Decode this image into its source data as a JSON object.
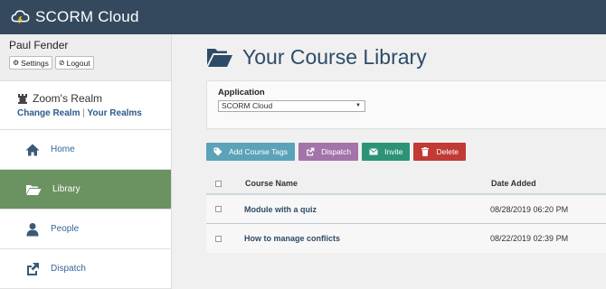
{
  "app": {
    "title": "SCORM Cloud"
  },
  "user": {
    "name": "Paul Fender",
    "settings_label": "Settings",
    "logout_label": "Logout"
  },
  "realm": {
    "name": "Zoom's Realm",
    "change_label": "Change Realm",
    "separator": "|",
    "your_realms_label": "Your Realms"
  },
  "nav": {
    "items": [
      {
        "label": "Home",
        "icon": "home-icon"
      },
      {
        "label": "Library",
        "icon": "folder-open-icon",
        "active": true
      },
      {
        "label": "People",
        "icon": "person-icon"
      },
      {
        "label": "Dispatch",
        "icon": "share-icon"
      }
    ]
  },
  "page": {
    "title": "Your Course Library"
  },
  "application": {
    "label": "Application",
    "selected": "SCORM Cloud"
  },
  "actions": {
    "add_tags": "Add Course Tags",
    "dispatch": "Dispatch",
    "invite": "Invite",
    "delete": "Delete"
  },
  "table": {
    "columns": [
      "Course Name",
      "Date Added"
    ],
    "rows": [
      {
        "name": "Module with a quiz",
        "date": "08/28/2019 06:20 PM"
      },
      {
        "name": "How to manage conflicts",
        "date": "08/22/2019 02:39 PM"
      }
    ]
  },
  "colors": {
    "topbar": "#34495e",
    "active_nav": "#6b9362",
    "tags": "#5aa3b8",
    "dispatch": "#a274a8",
    "invite": "#2d9377",
    "delete": "#c13a35"
  }
}
